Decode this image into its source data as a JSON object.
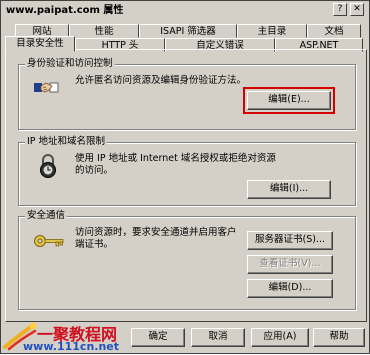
{
  "window": {
    "title": "www.paipat.com 属性",
    "help_glyph": "?",
    "close_glyph": "✕"
  },
  "tabs": {
    "row_top": [
      {
        "label": "网站"
      },
      {
        "label": "性能"
      },
      {
        "label": "ISAPI 筛选器"
      },
      {
        "label": "主目录"
      },
      {
        "label": "文档"
      }
    ],
    "row_bottom": [
      {
        "label": "目录安全性",
        "active": true
      },
      {
        "label": "HTTP 头"
      },
      {
        "label": "自定义错误"
      },
      {
        "label": "ASP.NET"
      }
    ]
  },
  "groups": {
    "auth": {
      "title": "身份验证和访问控制",
      "description": "允许匿名访问资源及编辑身份验证方法。",
      "edit_label": "编辑(E)...",
      "icon": "handshake-icon"
    },
    "ip": {
      "title": "IP 地址和域名限制",
      "description": "使用 IP 地址或 Internet 域名授权或拒绝对资源的访问。",
      "edit_label": "编辑(I)...",
      "icon": "lock-icon"
    },
    "secure": {
      "title": "安全通信",
      "description": "访问资源时，要求安全通道并启用客户端证书。",
      "server_cert_label": "服务器证书(S)...",
      "view_cert_label": "查看证书(V)...",
      "edit_label": "编辑(D)...",
      "icon": "key-icon"
    }
  },
  "footer": {
    "ok_label": "确定",
    "cancel_label": "取消",
    "apply_label": "应用(A)",
    "help_label": "帮助"
  },
  "watermark": {
    "brand": "一聚教程网",
    "url": "www.111cn.net"
  },
  "colors": {
    "dialog_bg": "#d4d0c8",
    "highlight": "#d40000",
    "watermark_red": "#d01020",
    "watermark_blue": "#2050c0"
  }
}
